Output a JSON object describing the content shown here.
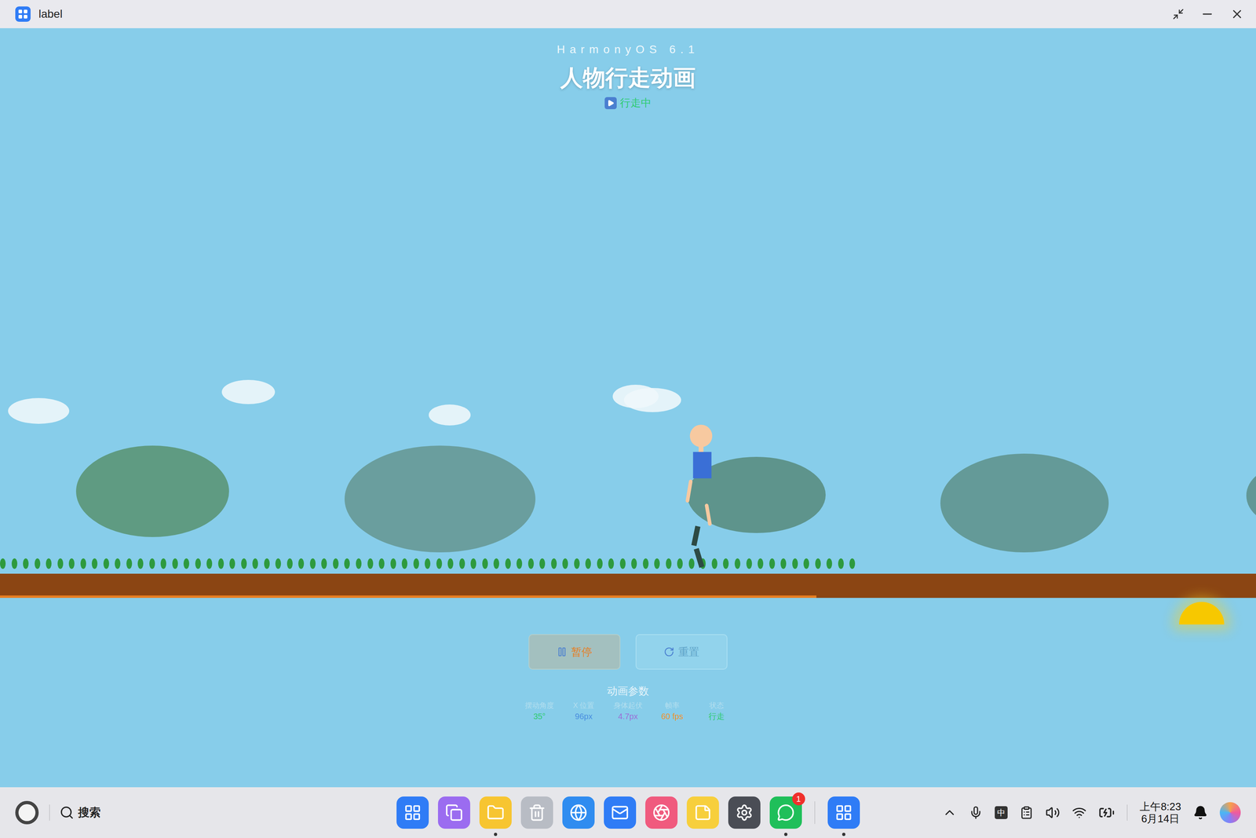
{
  "window": {
    "title": "label"
  },
  "header": {
    "subtitle": "HarmonyOS 6.1",
    "title": "人物行走动画",
    "status": {
      "text": "行走中",
      "playing": true
    }
  },
  "scene": {
    "progress": 0.65
  },
  "buttons": [
    {
      "label": "暂停",
      "kind": "pause"
    },
    {
      "label": "重置",
      "kind": "reset"
    }
  ],
  "params": {
    "title": "动画参数",
    "items": [
      {
        "label": "摆动角度",
        "value": "35°",
        "color": "#2ecc71"
      },
      {
        "label": "X 位置",
        "value": "96px",
        "color": "#4a8fe0"
      },
      {
        "label": "身体起伏",
        "value": "4.7px",
        "color": "#9b6fd8"
      },
      {
        "label": "帧率",
        "value": "60 fps",
        "color": "#f0932b"
      },
      {
        "label": "状态",
        "value": "行走",
        "color": "#2ecc71"
      }
    ]
  },
  "taskbar": {
    "search": "搜索",
    "dock": [
      {
        "kind": "launcher",
        "color": "#2f7cf6",
        "running": false
      },
      {
        "kind": "multitask",
        "color": "#9b6cf0",
        "running": false
      },
      {
        "kind": "files",
        "color": "#f7c531",
        "running": true
      },
      {
        "kind": "trash",
        "color": "#b8bcc4",
        "running": false
      },
      {
        "kind": "browser",
        "color": "#2f8cf0",
        "running": false
      },
      {
        "kind": "mail",
        "color": "#2f7cf6",
        "running": false
      },
      {
        "kind": "photos",
        "color": "#f05a7e",
        "running": false
      },
      {
        "kind": "notes",
        "color": "#f7cf3c",
        "running": false
      },
      {
        "kind": "settings",
        "color": "#4a4d55",
        "running": false
      },
      {
        "kind": "wechat",
        "color": "#1fbf5a",
        "running": true,
        "badge": "1"
      },
      {
        "kind": "app",
        "color": "#2f7cf6",
        "running": true
      }
    ],
    "ime": "中",
    "time": "上午8:23",
    "date": "6月14日"
  }
}
